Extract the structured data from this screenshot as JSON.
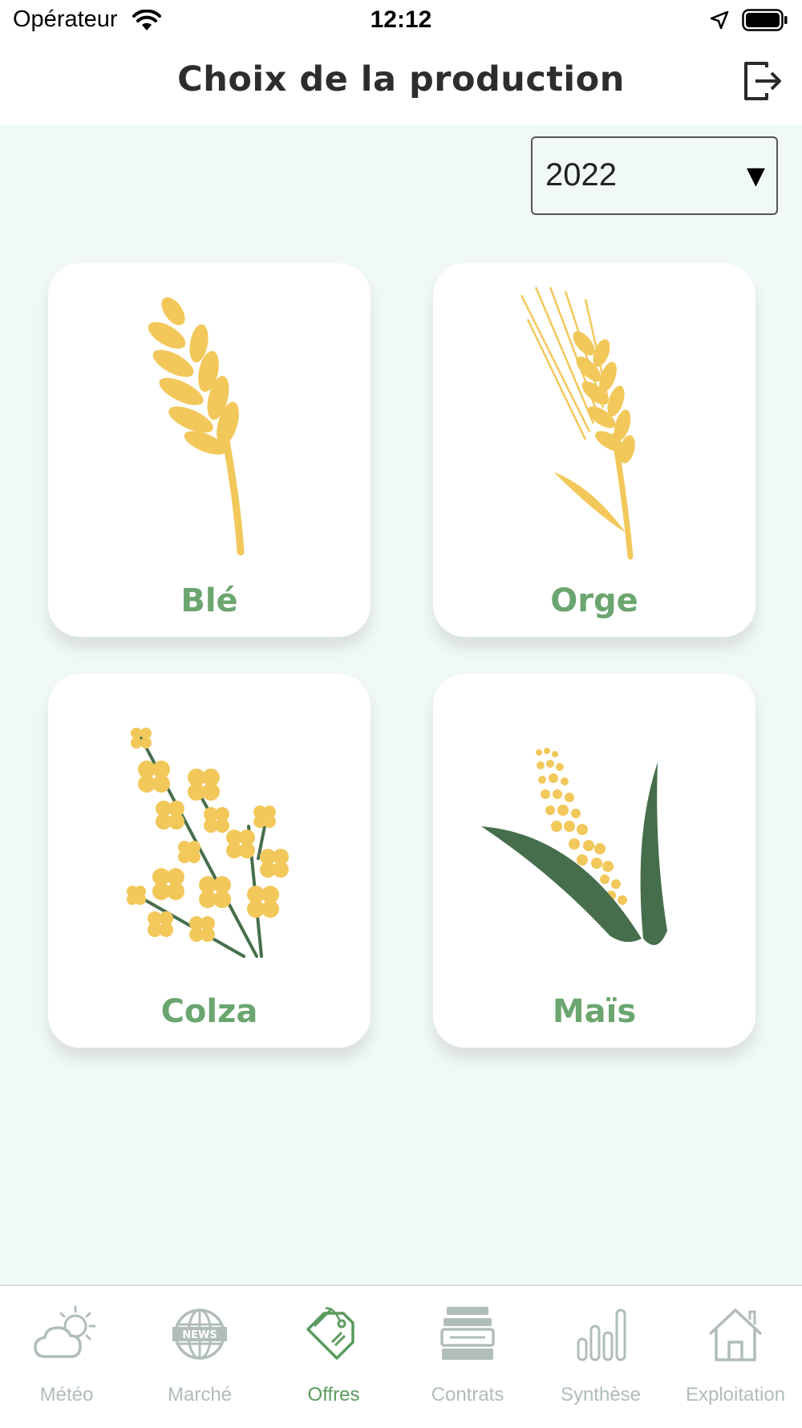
{
  "status_bar": {
    "carrier": "Opérateur",
    "time": "12:12"
  },
  "header": {
    "title": "Choix de la production"
  },
  "year_select": {
    "value": "2022",
    "arrow": "▼"
  },
  "productions": [
    {
      "label": "Blé",
      "icon": "wheat-icon"
    },
    {
      "label": "Orge",
      "icon": "barley-icon"
    },
    {
      "label": "Colza",
      "icon": "rapeseed-icon"
    },
    {
      "label": "Maïs",
      "icon": "corn-icon"
    }
  ],
  "tabs": [
    {
      "label": "Météo",
      "icon": "weather-icon",
      "active": false
    },
    {
      "label": "Marché",
      "icon": "news-globe-icon",
      "active": false
    },
    {
      "label": "Offres",
      "icon": "price-tag-icon",
      "active": true
    },
    {
      "label": "Contrats",
      "icon": "contracts-icon",
      "active": false
    },
    {
      "label": "Synthèse",
      "icon": "bar-chart-icon",
      "active": false
    },
    {
      "label": "Exploitation",
      "icon": "home-icon",
      "active": false
    }
  ],
  "colors": {
    "background": "#f1f9f6",
    "accent_green": "#6ba56f",
    "crop_yellow": "#f2c85b",
    "leaf_green": "#466e4c",
    "tab_inactive": "#b0bdb8"
  }
}
